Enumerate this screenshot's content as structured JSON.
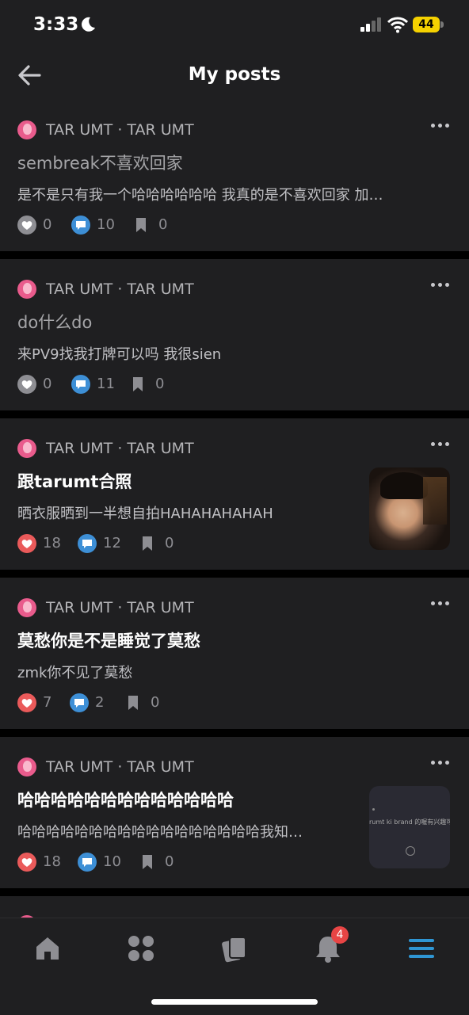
{
  "status": {
    "time": "3:33",
    "battery": "44"
  },
  "header": {
    "title": "My posts"
  },
  "posts": [
    {
      "author": "TAR UMT · TAR UMT",
      "title": "sembreak不喜欢回家",
      "excerpt": "是不是只有我一个哈哈哈哈哈哈 我真的是不喜欢回家 加…",
      "likes": "0",
      "comments": "10",
      "bookmarks": "0"
    },
    {
      "author": "TAR UMT · TAR UMT",
      "title": "do什么do",
      "excerpt": "来PV9找我打牌可以吗 我很sien",
      "likes": "0",
      "comments": "11",
      "bookmarks": "0"
    },
    {
      "author": "TAR UMT · TAR UMT",
      "title": "跟tarumt合照",
      "excerpt": "晒衣服晒到一半想自拍HAHAHAHAHAH",
      "likes": "18",
      "comments": "12",
      "bookmarks": "0"
    },
    {
      "author": "TAR UMT · TAR UMT",
      "title": "莫愁你是不是睡觉了莫愁",
      "excerpt": "zmk你不见了莫愁",
      "likes": "7",
      "comments": "2",
      "bookmarks": "0"
    },
    {
      "author": "TAR UMT · TAR UMT",
      "title": "哈哈哈哈哈哈哈哈哈哈哈哈哈",
      "excerpt": "哈哈哈哈哈哈哈哈哈哈哈哈哈哈哈哈哈我知…",
      "likes": "18",
      "comments": "10",
      "bookmarks": "0",
      "thumb_text": "rumt ki brand 的喔有兴趣可"
    }
  ],
  "tabs": {
    "notifications_badge": "4"
  },
  "colors": {
    "like_active": "#ea5a5a",
    "comment": "#3d8fd6",
    "accent": "#2f96d4",
    "badge": "#e84545"
  },
  "icons": [
    "back-arrow-icon",
    "more-icon",
    "heart-icon",
    "comment-icon",
    "bookmark-icon",
    "home-icon",
    "grid-icon",
    "cards-icon",
    "bell-icon",
    "menu-icon"
  ]
}
